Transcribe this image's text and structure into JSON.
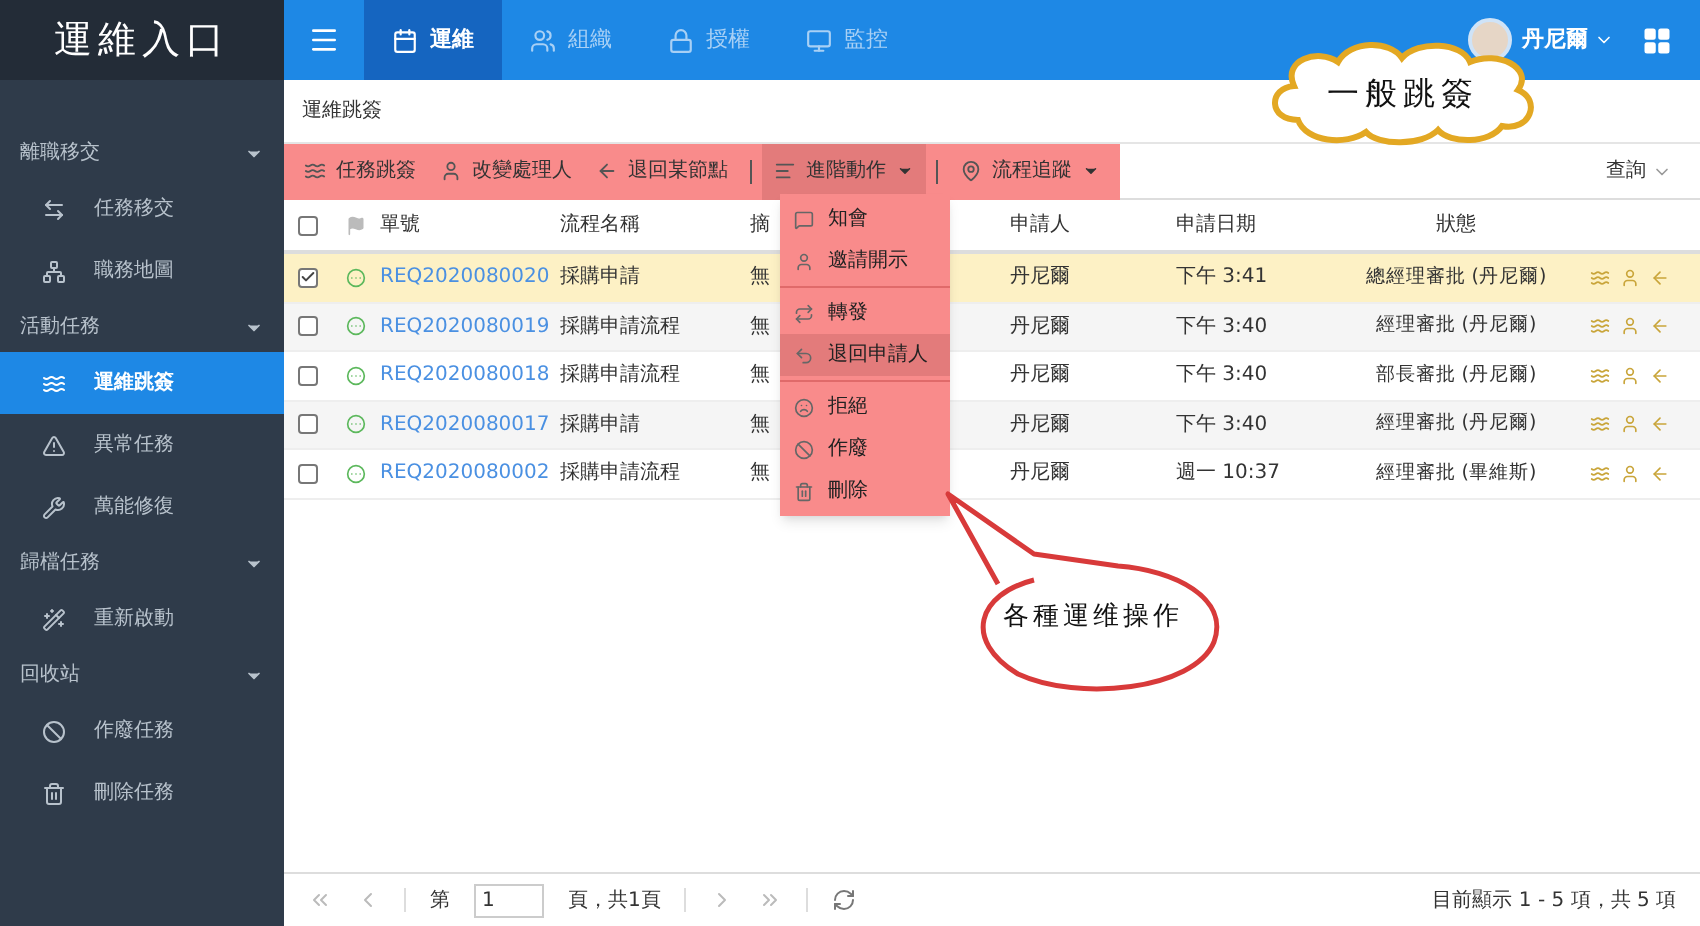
{
  "brand": "運維入口",
  "nav_tabs": [
    {
      "label": "運維",
      "selected": true
    },
    {
      "label": "組織",
      "selected": false
    },
    {
      "label": "授權",
      "selected": false
    },
    {
      "label": "監控",
      "selected": false
    }
  ],
  "user": {
    "name": "丹尼爾"
  },
  "sidebar": [
    {
      "label": "離職移交",
      "expanded": true,
      "children": [
        {
          "label": "任務移交",
          "selected": false
        },
        {
          "label": "職務地圖",
          "selected": false
        }
      ]
    },
    {
      "label": "活動任務",
      "expanded": true,
      "children": [
        {
          "label": "運維跳簽",
          "selected": true
        },
        {
          "label": "異常任務",
          "selected": false
        },
        {
          "label": "萬能修復",
          "selected": false
        }
      ]
    },
    {
      "label": "歸檔任務",
      "expanded": true,
      "children": [
        {
          "label": "重新啟動",
          "selected": false
        }
      ]
    },
    {
      "label": "回收站",
      "expanded": true,
      "children": [
        {
          "label": "作廢任務",
          "selected": false
        },
        {
          "label": "刪除任務",
          "selected": false
        }
      ]
    }
  ],
  "breadcrumb": "運維跳簽",
  "toolbar": [
    {
      "label": "任務跳簽",
      "kind": "button",
      "open": false
    },
    {
      "label": "改變處理人",
      "kind": "button",
      "open": false
    },
    {
      "label": "退回某節點",
      "kind": "button",
      "open": false
    },
    {
      "label": "進階動作",
      "kind": "dropdown",
      "open": true
    },
    {
      "label": "流程追蹤",
      "kind": "dropdown",
      "open": false
    }
  ],
  "query_button": "查詢",
  "table": {
    "select_all": {
      "checked": false
    },
    "columns": [
      "單號",
      "流程名稱",
      "摘",
      "申請人",
      "申請日期",
      "狀態"
    ],
    "rows": [
      {
        "checked": true,
        "id": "REQ2020080020",
        "process": "採購申請",
        "summary": "無",
        "applicant": "丹尼爾",
        "date": "下午 3:41",
        "status": "總經理審批 (丹尼爾)"
      },
      {
        "checked": false,
        "id": "REQ2020080019",
        "process": "採購申請流程",
        "summary": "無",
        "applicant": "丹尼爾",
        "date": "下午 3:40",
        "status": "經理審批 (丹尼爾)"
      },
      {
        "checked": false,
        "id": "REQ2020080018",
        "process": "採購申請流程",
        "summary": "無",
        "applicant": "丹尼爾",
        "date": "下午 3:40",
        "status": "部長審批 (丹尼爾)"
      },
      {
        "checked": false,
        "id": "REQ2020080017",
        "process": "採購申請",
        "summary": "無",
        "applicant": "丹尼爾",
        "date": "下午 3:40",
        "status": "經理審批 (丹尼爾)"
      },
      {
        "checked": false,
        "id": "REQ2020080002",
        "process": "採購申請流程",
        "summary": "無",
        "applicant": "丹尼爾",
        "date": "週一 10:37",
        "status": "經理審批 (畢維斯)"
      }
    ]
  },
  "menu": [
    [
      {
        "label": "知會",
        "selected": false
      },
      {
        "label": "邀請開示",
        "selected": false
      }
    ],
    [
      {
        "label": "轉發",
        "selected": false
      },
      {
        "label": "退回申請人",
        "selected": true
      }
    ],
    [
      {
        "label": "拒絕",
        "selected": false
      },
      {
        "label": "作廢",
        "selected": false
      },
      {
        "label": "刪除",
        "selected": false
      }
    ]
  ],
  "pager": {
    "page_label": "第",
    "page": "1",
    "of_pages": "頁，共1頁",
    "summary": "目前顯示 1 - 5 項，共 5 項"
  },
  "callouts": [
    {
      "kind": "cloud",
      "text": "一般跳簽"
    },
    {
      "kind": "bubble",
      "text": "各種運维操作"
    }
  ]
}
